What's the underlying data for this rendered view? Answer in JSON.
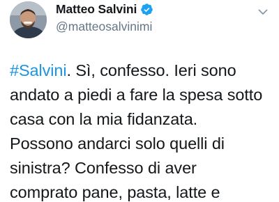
{
  "author": {
    "display_name": "Matteo Salvini",
    "handle": "@matteosalvinimi",
    "verified": true
  },
  "tweet": {
    "hashtag": "#Salvini",
    "lines": [
      ". Sì, confesso. Ieri sono",
      "andato a piedi a fare la spesa sotto",
      "casa con la mia fidanzata.",
      "Possono andarci solo quelli di",
      "sinistra? Confesso di aver",
      "comprato pane, pasta, latte e"
    ]
  },
  "colors": {
    "hashtag": "#1b95e0",
    "verified_badge": "#1da1f2",
    "handle": "#657786",
    "text": "#14171a"
  },
  "icons": {
    "verified": "verified-badge-icon",
    "menu": "chevron-down-icon"
  }
}
